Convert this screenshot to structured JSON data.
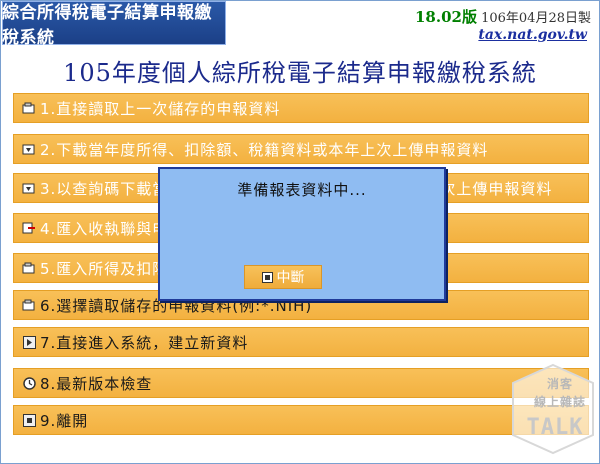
{
  "header": {
    "app_title": "綜合所得稅電子結算申報繳稅系統",
    "version": "18.02版",
    "build_date": "106年04月28日製",
    "site": "tax.nat.gov.tw",
    "main_title": "105年度個人綜所稅電子結算申報繳稅系統"
  },
  "menu": {
    "items": [
      {
        "label": "1.直接讀取上一次儲存的申報資料",
        "icon": "open-file-icon"
      },
      {
        "label": "2.下載當年度所得、扣除額、稅籍資料或本年上次上傳申報資料",
        "icon": "download-icon"
      },
      {
        "label": "3.以查詢碼下載當年度所得、扣除額、稅籍資料或本年上次上傳申報資料",
        "icon": "query-download-icon"
      },
      {
        "label": "4.匯入收執聯與申報書列印資料(例:*.Prn)",
        "icon": "import-print-icon"
      },
      {
        "label": "5.匯入所得及扣除額資料下載檔(例:*.DAT)",
        "icon": "import-data-icon"
      },
      {
        "label": "6.選擇讀取儲存的申報資料(例:*.NIH)",
        "icon": "select-file-icon"
      },
      {
        "label": "7.直接進入系統，建立新資料",
        "icon": "enter-icon"
      },
      {
        "label": "8.最新版本檢查",
        "icon": "clock-icon"
      },
      {
        "label": "9.離開",
        "icon": "exit-icon"
      }
    ]
  },
  "dialog": {
    "title": "準備報表資料中...",
    "button_label": "中斷"
  },
  "watermark": {
    "line1": "消客",
    "line2": "線上雜誌",
    "logo": "TALK"
  },
  "colors": {
    "menu_bg": "#f5b74a",
    "dialog_bg": "#8fbcf2",
    "title_blue": "#1b2a8c",
    "version_green": "#008000"
  }
}
